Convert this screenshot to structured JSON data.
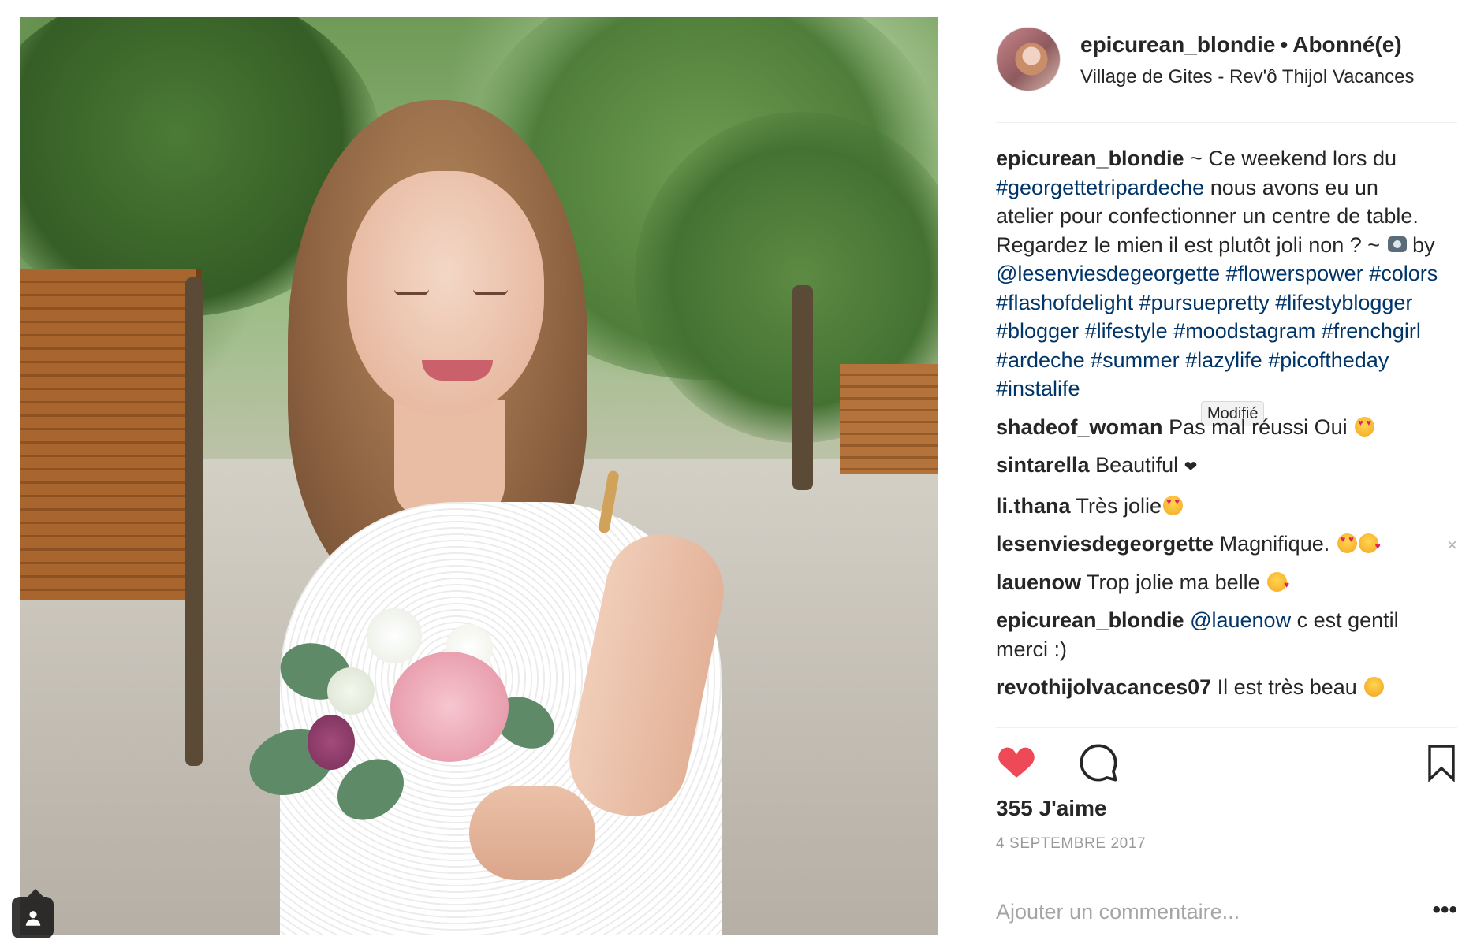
{
  "post": {
    "author": "epicurean_blondie",
    "separator": "•",
    "follow_status": "Abonné(e)",
    "location": "Village de Gites - Rev'ô Thijol Vacances"
  },
  "caption": {
    "user": "epicurean_blondie",
    "text_1": "~ Ce weekend lors du",
    "tag_1": "#georgettetripardeche",
    "text_2": "nous avons eu un atelier pour confectionner un centre de table. Regardez le mien il est plutôt joli non ? ~",
    "text_3": "by",
    "mention": "@lesenviesdegeorgette",
    "tags": [
      "#flowerspower",
      "#colors",
      "#flashofdelight",
      "#pursuepretty",
      "#lifestyblogger",
      "#blogger",
      "#lifestyle",
      "#moodstagram",
      "#frenchgirl",
      "#ardeche",
      "#summer",
      "#lazylife",
      "#picoftheday",
      "#instalife"
    ],
    "tooltip": "Modifié"
  },
  "comments": [
    {
      "user": "shadeof_woman",
      "text": "Pas mal réussi Oui"
    },
    {
      "user": "sintarella",
      "text": "Beautiful"
    },
    {
      "user": "li.thana",
      "text": "Très jolie"
    },
    {
      "user": "lesenviesdegeorgette",
      "text": "Magnifique."
    },
    {
      "user": "lauenow",
      "text": "Trop jolie ma belle"
    },
    {
      "user": "epicurean_blondie",
      "mention": "@lauenow",
      "text": "c est gentil merci :)"
    },
    {
      "user": "revothijolvacances07",
      "text": "Il est très beau"
    }
  ],
  "delete_label": "×",
  "likes": "355 J'aime",
  "date": "4 SEPTEMBRE 2017",
  "add_comment_placeholder": "Ajouter un commentaire...",
  "more_label": "•••",
  "icons": {
    "like": "heart-filled-icon",
    "comment": "speech-bubble-icon",
    "save": "bookmark-icon",
    "user_tag": "person-icon"
  },
  "colors": {
    "like_red": "#ed4956",
    "link_blue": "#003569",
    "muted": "#999999"
  }
}
